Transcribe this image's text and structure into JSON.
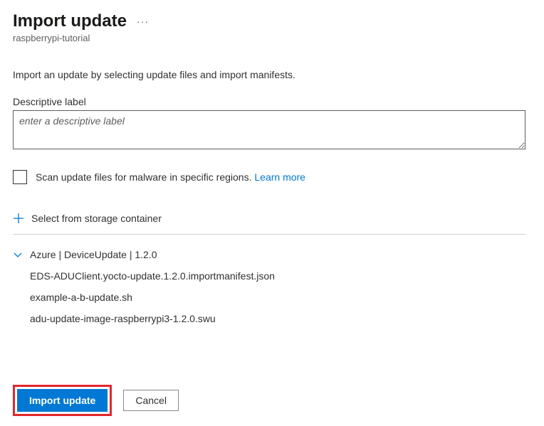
{
  "header": {
    "title": "Import update",
    "subtitle": "raspberrypi-tutorial"
  },
  "description": "Import an update by selecting update files and import manifests.",
  "label_field": {
    "label": "Descriptive label",
    "placeholder": "enter a descriptive label"
  },
  "scan_option": {
    "text": "Scan update files for malware in specific regions.",
    "link": "Learn more"
  },
  "storage_action": "Select from storage container",
  "update_group": {
    "title": "Azure | DeviceUpdate | 1.2.0",
    "files": [
      "EDS-ADUClient.yocto-update.1.2.0.importmanifest.json",
      "example-a-b-update.sh",
      "adu-update-image-raspberrypi3-1.2.0.swu"
    ]
  },
  "buttons": {
    "primary": "Import update",
    "secondary": "Cancel"
  }
}
